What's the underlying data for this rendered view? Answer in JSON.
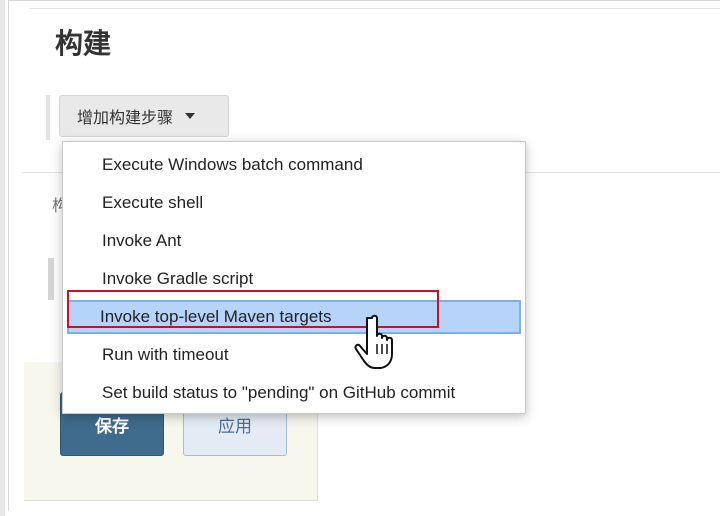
{
  "section": {
    "title": "构建"
  },
  "add_step": {
    "label": "增加构建步骤"
  },
  "background": {
    "ghost_text": "构"
  },
  "dropdown": {
    "items": [
      {
        "label": "Execute Windows batch command",
        "highlighted": false
      },
      {
        "label": "Execute shell",
        "highlighted": false
      },
      {
        "label": "Invoke Ant",
        "highlighted": false
      },
      {
        "label": "Invoke Gradle script",
        "highlighted": false
      },
      {
        "label": "Invoke top-level Maven targets",
        "highlighted": true
      },
      {
        "label": "Run with timeout",
        "highlighted": false
      },
      {
        "label": "Set build status to \"pending\" on GitHub commit",
        "highlighted": false
      }
    ]
  },
  "footer": {
    "save_label": "保存",
    "apply_label": "应用"
  },
  "icons": {
    "caret": "caret-down-icon",
    "cursor": "hand-pointer-icon"
  },
  "colors": {
    "highlight_bg": "#b6d4f7",
    "highlight_border": "#7eb0ea",
    "annotation": "#c8102e",
    "save_bg": "#3f6b8c",
    "apply_bg": "#e3ecf5"
  }
}
